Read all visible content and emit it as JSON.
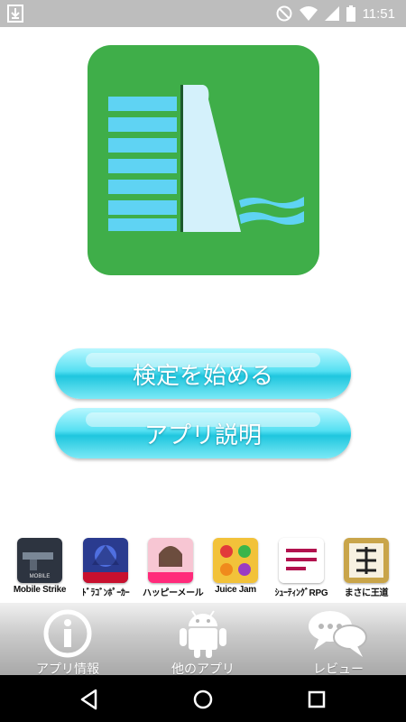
{
  "status_bar": {
    "time": "11:51",
    "icons": [
      "download-icon",
      "do-not-disturb-icon",
      "wifi-icon",
      "cellular-icon",
      "battery-icon"
    ]
  },
  "main_buttons": {
    "start_label": "検定を始める",
    "app_info_label": "アプリ説明"
  },
  "promo_apps": [
    {
      "name": "Mobile Strike"
    },
    {
      "name": "ﾄﾞﾗｺﾞﾝﾎﾟｰｶｰ"
    },
    {
      "name": "ハッピーメール"
    },
    {
      "name": "Juice Jam"
    },
    {
      "name": "ｼｭｰﾃｨﾝｸﾞRPG"
    },
    {
      "name": "まさに王道"
    }
  ],
  "tabs": [
    {
      "label": "アプリ情報",
      "icon": "info-icon"
    },
    {
      "label": "他のアプリ",
      "icon": "android-icon"
    },
    {
      "label": "レビュー",
      "icon": "speech-bubble-icon"
    }
  ],
  "colors": {
    "logo_green": "#3fae49",
    "logo_blue": "#5fd3f3",
    "button_cyan": "#1fc6de"
  }
}
